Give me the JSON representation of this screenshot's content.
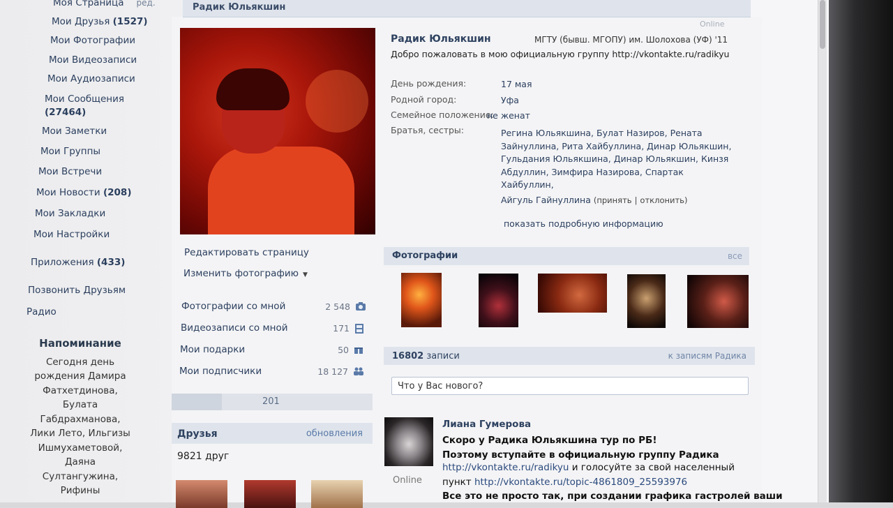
{
  "left_nav": {
    "items": [
      {
        "label": "Моя Страница",
        "count": "",
        "edit": "ред."
      },
      {
        "label": "Мои Друзья",
        "count": "(1527)"
      },
      {
        "label": "Мои Фотографии",
        "count": ""
      },
      {
        "label": "Мои Видеозаписи",
        "count": ""
      },
      {
        "label": "Мои Аудиозаписи",
        "count": ""
      },
      {
        "label": "Мои Сообщения",
        "count": "(27464)"
      },
      {
        "label": "Мои Заметки",
        "count": ""
      },
      {
        "label": "Мои Группы",
        "count": ""
      },
      {
        "label": "Мои Встречи",
        "count": ""
      },
      {
        "label": "Мои Новости",
        "count": "(208)"
      },
      {
        "label": "Мои Закладки",
        "count": ""
      },
      {
        "label": "Мои Настройки",
        "count": ""
      },
      {
        "label": "Приложения",
        "count": "(433)"
      },
      {
        "label": "Позвонить Друзьям",
        "count": ""
      },
      {
        "label": "Радио",
        "count": ""
      }
    ]
  },
  "reminder": {
    "title": "Напоминание",
    "lines": [
      "Сегодня день",
      "рождения Дамира",
      "Фатхетдинова,",
      "Булата",
      "Габдрахманова,",
      "Лики Лето, Ильгизы",
      "Ишмухаметовой,",
      "Даяна",
      "Султангужина,",
      "Рифины"
    ]
  },
  "header": {
    "name": "Радик Юльякшин"
  },
  "profile": {
    "online": "Online",
    "name": "Радик Юльякшин",
    "university": "МГТУ (бывш. МГОПУ) им. Шолохова (УФ) '11",
    "status": "Добро пожаловать в мою официальную группу http://vkontakte.ru/radikyu",
    "rows": [
      {
        "label": "День рождения:",
        "value": "17 мая"
      },
      {
        "label": "Родной город:",
        "value": "Уфа"
      },
      {
        "label": "Семейное положение:",
        "value": "не женат"
      },
      {
        "label": "Братья, сестры:",
        "value": "Регина Юльякшина, Булат Назиров, Рената Зайнуллина, Рита Хайбуллина, Динар Юльякшин, Гульдания Юльякшина, Динар Юльякшин, Кинзя Абдуллин, Зимфира Назирова, Спартак Хайбуллин,"
      }
    ],
    "sibling_pending": "Айгуль Гайнуллина",
    "accept": "(принять",
    "sep": "|",
    "decline": "отклонить)",
    "more": "показать подробную информацию"
  },
  "actions": {
    "edit_page": "Редактировать страницу",
    "change_photo": "Изменить фотографию",
    "caret": "▼"
  },
  "counters": [
    {
      "label": "Фотографии со мной",
      "value": "2 548"
    },
    {
      "label": "Видеозаписи со мной",
      "value": "171"
    },
    {
      "label": "Мои подарки",
      "value": "50"
    },
    {
      "label": "Мои подписчики",
      "value": "18 127"
    }
  ],
  "pager": {
    "label": "201"
  },
  "friends": {
    "title": "Друзья",
    "updates": "обновления",
    "count": "9821 друг"
  },
  "photos": {
    "title": "Фотографии",
    "all": "все"
  },
  "wall": {
    "count": "16802",
    "count_label": "записи",
    "to_posts": "к записям Радика",
    "input_value": "Что у Вас нового?"
  },
  "post": {
    "author": "Лиана Гумерова",
    "online": "Online",
    "line1": "Скоро у Радика Юльякшина тур по РБ!",
    "line2": "Поэтому вступайте в официальную группу Радика",
    "line3_link": "http://vkontakte.ru/radikyu",
    "line3_rest": " и голосуйте за свой населенный",
    "line4_pre": "пункт ",
    "line4_link": "http://vkontakte.ru/topic-4861809_25593976",
    "line5": "Все это не просто так, при создании графика гастролей ваши"
  }
}
